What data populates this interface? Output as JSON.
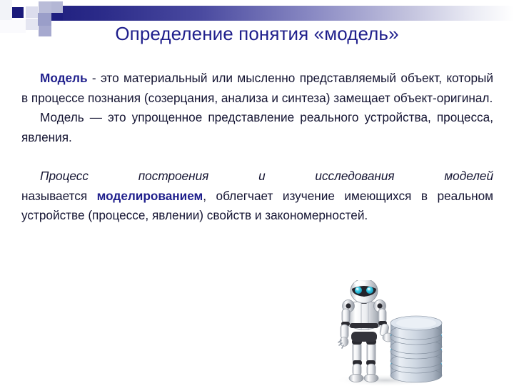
{
  "slide": {
    "title": "Определение понятия «модель»",
    "title_color": "#1f1f8c",
    "background_color": "#ffffff",
    "body_color": "#141432",
    "accent_color": "#1f1f8c"
  },
  "header": {
    "gradient_from": "#1e1e7e",
    "gradient_to": "#ffffff",
    "square_dark": "#1a1a7a",
    "square_mid": "#9a9ec9",
    "square_light": "#e8e9f3"
  },
  "body": {
    "p1": {
      "lead": "Модель",
      "rest": " - это материальный или мысленно представляемый объект, который в процессе познания (созерцания, анализа и синтеза) замещает объект-оригинал."
    },
    "p2": {
      "text": "Модель — это упрощенное представление реального устройства, процесса, явления."
    },
    "p3": {
      "italic_lead": "Процесс построения и исследования моделей",
      "mid": " называется ",
      "bold": "моделированием",
      "tail": ", облегчает изучение имеющихся в реальном устройстве (процессе, явлении) свойств и закономерностей."
    }
  },
  "illustration": {
    "name": "robot-with-database-image",
    "robot_body_color": "#f2f3f5",
    "robot_joint_color": "#2a2a30",
    "robot_eye_color": "#2ec7e0",
    "database_disc_color": "#c6cddb",
    "database_glow_color": "#5fd0f0"
  }
}
